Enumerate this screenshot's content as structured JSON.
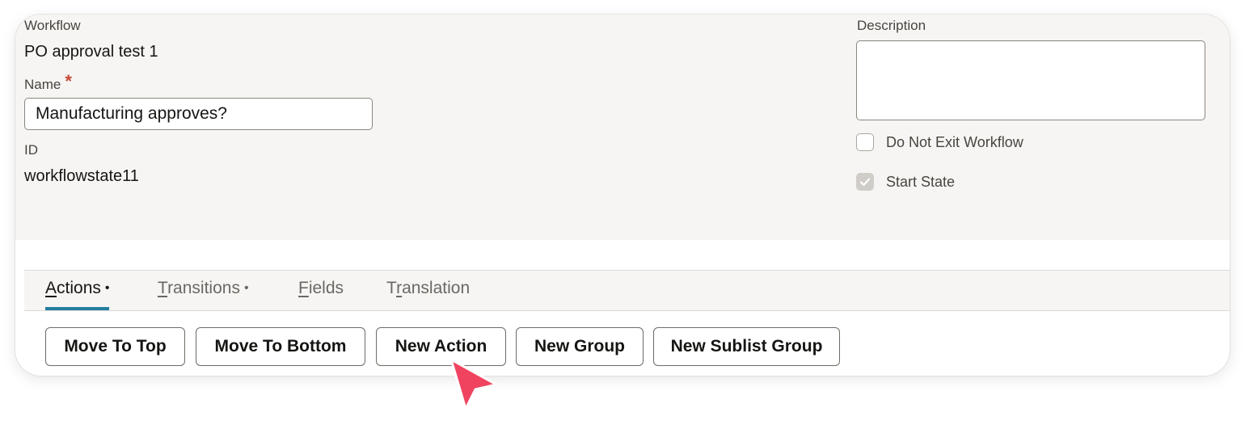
{
  "form": {
    "workflow_label": "Workflow",
    "workflow_value": "PO approval test 1",
    "name_label": "Name",
    "required_mark": "*",
    "name_value": "Manufacturing approves?",
    "id_label": "ID",
    "id_value": "workflowstate11",
    "description_label": "Description",
    "description_value": "",
    "do_not_exit_label": "Do Not Exit Workflow",
    "do_not_exit_checked": false,
    "start_state_label": "Start State",
    "start_state_checked": true
  },
  "tabs": [
    {
      "key": "A",
      "rest": "ctions",
      "dot": "•",
      "active": true
    },
    {
      "key": "T",
      "rest": "ransitions",
      "dot": "•",
      "active": false
    },
    {
      "key": "F",
      "rest": "ields",
      "dot": "",
      "active": false
    },
    {
      "pre": "T",
      "key": "r",
      "rest": "anslation",
      "dot": "",
      "active": false
    }
  ],
  "toolbar": {
    "move_to_top": "Move To Top",
    "move_to_bottom": "Move To Bottom",
    "new_action": "New Action",
    "new_group": "New Group",
    "new_sublist_group": "New Sublist Group"
  },
  "colors": {
    "tab_active_underline": "#227e9e",
    "required": "#c74634",
    "cursor": "#f0435f"
  }
}
